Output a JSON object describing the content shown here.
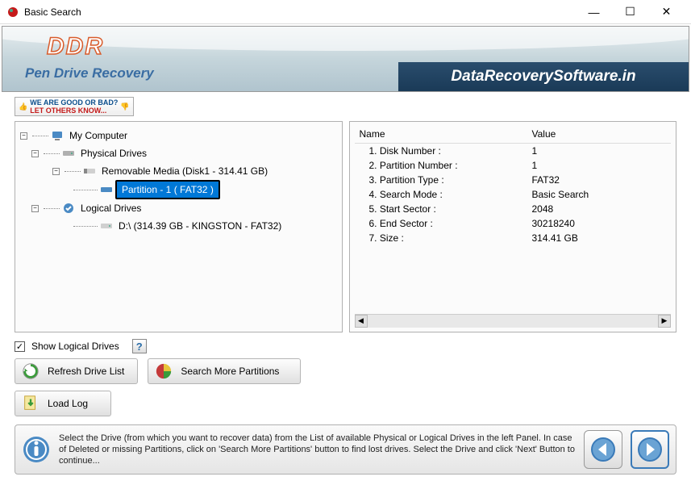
{
  "window": {
    "title": "Basic Search"
  },
  "banner": {
    "logo": "DDR",
    "subtitle": "Pen Drive Recovery",
    "brand": "DataRecoverySoftware.in"
  },
  "review": {
    "line1": "WE ARE GOOD OR BAD?",
    "line2": "LET OTHERS KNOW..."
  },
  "tree": {
    "root": "My Computer",
    "physical": "Physical Drives",
    "removable": "Removable Media (Disk1 - 314.41 GB)",
    "partition": "Partition - 1 ( FAT32 )",
    "logical": "Logical Drives",
    "drive_d": "D:\\ (314.39 GB - KINGSTON - FAT32)"
  },
  "details": {
    "col_name": "Name",
    "col_value": "Value",
    "rows": [
      {
        "name": "1. Disk Number :",
        "value": "1"
      },
      {
        "name": "2. Partition Number :",
        "value": "1"
      },
      {
        "name": "3. Partition Type :",
        "value": "FAT32"
      },
      {
        "name": "4. Search Mode :",
        "value": "Basic Search"
      },
      {
        "name": "5. Start Sector :",
        "value": "2048"
      },
      {
        "name": "6. End Sector :",
        "value": "30218240"
      },
      {
        "name": "7. Size :",
        "value": "314.41 GB"
      }
    ]
  },
  "options": {
    "show_logical": "Show Logical Drives"
  },
  "buttons": {
    "refresh": "Refresh Drive List",
    "search_more": "Search More Partitions",
    "load_log": "Load Log"
  },
  "footer": {
    "text": "Select the Drive (from which you want to recover data) from the List of available Physical or Logical Drives in the left Panel. In case of Deleted or missing Partitions, click on 'Search More Partitions' button to find lost drives. Select the Drive and click 'Next' Button to continue..."
  }
}
